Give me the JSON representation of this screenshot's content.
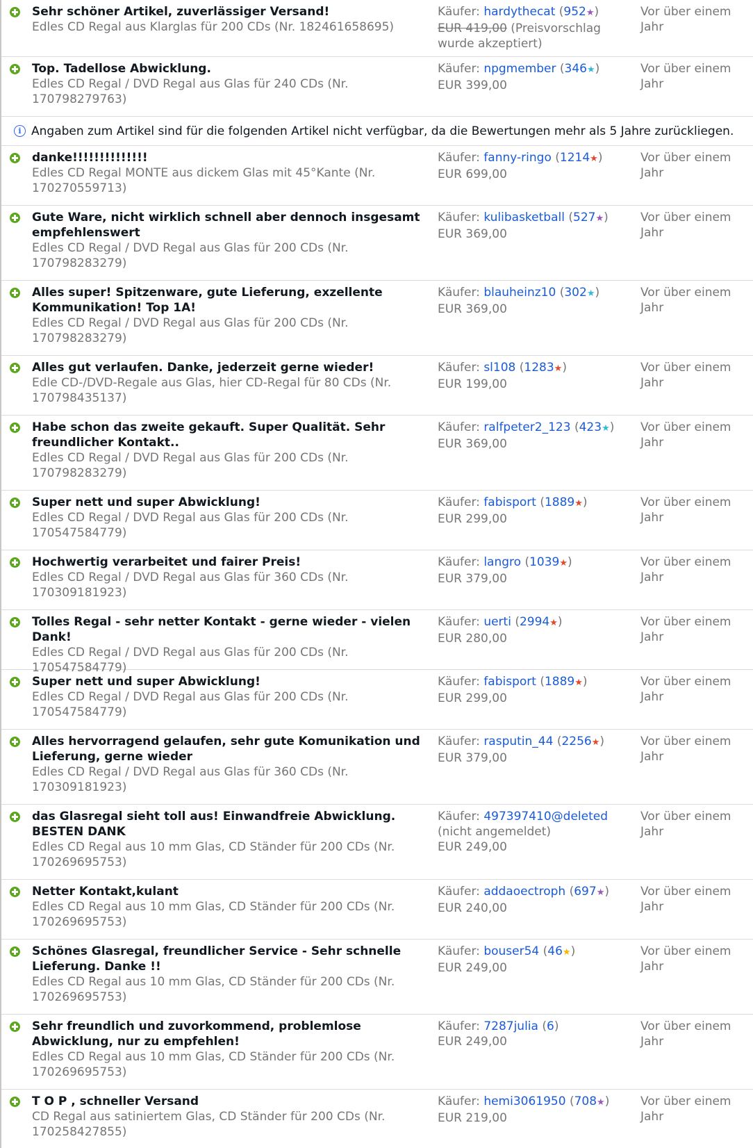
{
  "notice": "Angaben zum Artikel sind für die folgenden Artikel nicht verfügbar, da die Bewertungen mehr als 5 Jahre zurückliegen.",
  "buyer_label": "Käufer:",
  "colors": {
    "positive": "#5ba71b",
    "link": "#1a5bd6",
    "muted": "#767676"
  },
  "rows_top": [
    {
      "comment": "Sehr schöner Artikel, zuverlässiger Versand!",
      "item": "Edles CD Regal aus Klarglas für 200 CDs (Nr. 182461658695)",
      "user": "hardythecat",
      "score": "952",
      "star_color": "#9b59b6",
      "price_strike": "EUR 419,00",
      "price": "(Preisvorschlag wurde akzeptiert)",
      "note": "",
      "time": "Vor über einem Jahr"
    },
    {
      "comment": "Top. Tadellose Abwicklung.",
      "item": "Edles CD Regal / DVD Regal aus Glas für 240 CDs (Nr. 170798279763)",
      "user": "npgmember",
      "score": "346",
      "star_color": "#36b9d9",
      "price_strike": "",
      "price": "EUR 399,00",
      "note": "",
      "time": "Vor über einem Jahr"
    }
  ],
  "rows_bottom": [
    {
      "comment": "danke!!!!!!!!!!!!!!",
      "item": "Edles CD Regal MONTE aus dickem Glas mit 45°Kante (Nr. 170270559713)",
      "user": "fanny-ringo",
      "score": "1214",
      "star_color": "#e04b2f",
      "price_strike": "",
      "price": "EUR 699,00",
      "note": "",
      "time": "Vor über einem Jahr"
    },
    {
      "comment": "Gute Ware, nicht wirklich schnell aber dennoch insgesamt empfehlenswert",
      "item": "Edles CD Regal / DVD Regal aus Glas für 200 CDs (Nr. 170798283279)",
      "user": "kulibasketball",
      "score": "527",
      "star_color": "#9b59b6",
      "price_strike": "",
      "price": "EUR 369,00",
      "note": "",
      "time": "Vor über einem Jahr"
    },
    {
      "comment": "Alles super! Spitzenware, gute Lieferung, exzellente Kommunikation! Top 1A!",
      "item": "Edles CD Regal / DVD Regal aus Glas für 200 CDs (Nr. 170798283279)",
      "user": "blauheinz10",
      "score": "302",
      "star_color": "#36b9d9",
      "price_strike": "",
      "price": "EUR 369,00",
      "note": "",
      "time": "Vor über einem Jahr"
    },
    {
      "comment": "Alles gut verlaufen. Danke, jederzeit gerne wieder!",
      "item": "Edle CD-/DVD-Regale aus Glas, hier CD-Regal für 80 CDs (Nr. 170798435137)",
      "user": "sl108",
      "score": "1283",
      "star_color": "#e04b2f",
      "price_strike": "",
      "price": "EUR 199,00",
      "note": "",
      "time": "Vor über einem Jahr"
    },
    {
      "comment": "Habe schon das zweite gekauft. Super Qualität. Sehr freundlicher Kontakt..",
      "item": "Edles CD Regal / DVD Regal aus Glas für 200 CDs (Nr. 170798283279)",
      "user": "ralfpeter2_123",
      "score": "423",
      "star_color": "#36b9d9",
      "price_strike": "",
      "price": "EUR 369,00",
      "note": "",
      "time": "Vor über einem Jahr"
    },
    {
      "comment": "Super nett und super Abwicklung!",
      "item": "Edles CD Regal / DVD Regal aus Glas für 200 CDs (Nr. 170547584779)",
      "user": "fabisport",
      "score": "1889",
      "star_color": "#e04b2f",
      "price_strike": "",
      "price": "EUR 299,00",
      "note": "",
      "time": "Vor über einem Jahr"
    },
    {
      "comment": "Hochwertig verarbeitet und fairer Preis!",
      "item": "Edles CD Regal / DVD Regal aus Glas für 360 CDs (Nr. 170309181923)",
      "user": "langro",
      "score": "1039",
      "star_color": "#e04b2f",
      "price_strike": "",
      "price": "EUR 379,00",
      "note": "",
      "time": "Vor über einem Jahr"
    },
    {
      "comment": "Tolles Regal - sehr netter Kontakt - gerne wieder - vielen Dank!",
      "item": "Edles CD Regal / DVD Regal aus Glas für 200 CDs (Nr. 170547584779)",
      "user": "uerti",
      "score": "2994",
      "star_color": "#e04b2f",
      "price_strike": "",
      "price": "EUR 280,00",
      "note": "",
      "time": "Vor über einem Jahr"
    },
    {
      "comment": "Super nett und super Abwicklung!",
      "item": "Edles CD Regal / DVD Regal aus Glas für 200 CDs (Nr. 170547584779)",
      "user": "fabisport",
      "score": "1889",
      "star_color": "#e04b2f",
      "price_strike": "",
      "price": "EUR 299,00",
      "note": "",
      "time": "Vor über einem Jahr"
    },
    {
      "comment": "Alles hervorragend gelaufen, sehr gute Komunikation und Lieferung, gerne wieder",
      "item": "Edles CD Regal / DVD Regal aus Glas für 360 CDs (Nr. 170309181923)",
      "user": "rasputin_44",
      "score": "2256",
      "star_color": "#e04b2f",
      "price_strike": "",
      "price": "EUR 379,00",
      "note": "",
      "time": "Vor über einem Jahr"
    },
    {
      "comment": "das Glasregal sieht toll aus! Einwandfreie Abwicklung. BESTEN DANK",
      "item": "Edles CD Regal aus 10 mm Glas, CD Ständer für 200 CDs (Nr. 170269695753)",
      "user": "497397410@deleted",
      "score": "",
      "star_color": "",
      "price_strike": "",
      "price": "EUR 249,00",
      "note": "(nicht angemeldet)",
      "time": "Vor über einem Jahr"
    },
    {
      "comment": "Netter Kontakt,kulant",
      "item": "Edles CD Regal aus 10 mm Glas, CD Ständer für 200 CDs (Nr. 170269695753)",
      "user": "addaoectroph",
      "score": "697",
      "star_color": "#9b59b6",
      "price_strike": "",
      "price": "EUR 240,00",
      "note": "",
      "time": "Vor über einem Jahr"
    },
    {
      "comment": "Schönes Glasregal, freundlicher Service - Sehr schnelle Lieferung. Danke !!",
      "item": "Edles CD Regal aus 10 mm Glas, CD Ständer für 200 CDs (Nr. 170269695753)",
      "user": "bouser54",
      "score": "46",
      "star_color": "#f5b800",
      "price_strike": "",
      "price": "EUR 249,00",
      "note": "",
      "time": "Vor über einem Jahr"
    },
    {
      "comment": "Sehr freundlich und zuvorkommend, problemlose Abwicklung, nur zu empfehlen!",
      "item": "Edles CD Regal aus 10 mm Glas, CD Ständer für 200 CDs (Nr. 170269695753)",
      "user": "7287julia",
      "score": "6",
      "star_color": "",
      "price_strike": "",
      "price": "EUR 249,00",
      "note": "",
      "time": "Vor über einem Jahr"
    },
    {
      "comment": "T O P , schneller Versand",
      "item": "CD Regal aus satiniertem Glas, CD Ständer für 200 CDs (Nr. 170258427855)",
      "user": "hemi3061950",
      "score": "708",
      "star_color": "#9b59b6",
      "price_strike": "",
      "price": "EUR 219,00",
      "note": "",
      "time": "Vor über einem Jahr"
    }
  ]
}
